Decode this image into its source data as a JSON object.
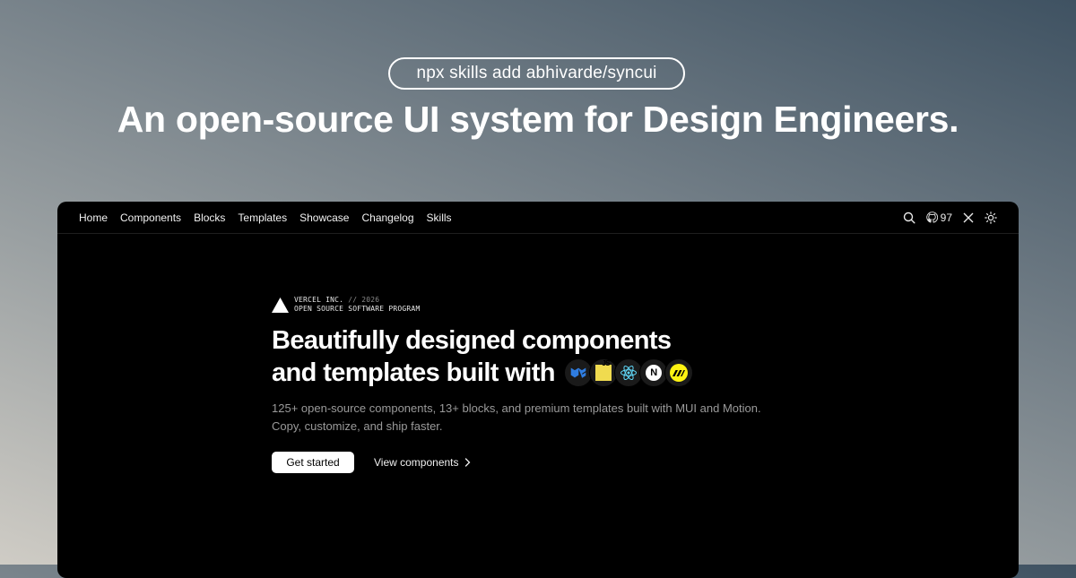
{
  "top": {
    "command": "npx skills add abhivarde/syncui",
    "headline": "An open-source UI system for Design Engineers."
  },
  "nav": {
    "items": [
      {
        "label": "Home"
      },
      {
        "label": "Components"
      },
      {
        "label": "Blocks"
      },
      {
        "label": "Templates"
      },
      {
        "label": "Showcase"
      },
      {
        "label": "Changelog"
      },
      {
        "label": "Skills"
      }
    ],
    "github_stars": "97",
    "icons": [
      "search-icon",
      "github-icon",
      "x-icon",
      "sun-icon"
    ]
  },
  "hero": {
    "badge_org": "VERCEL INC.",
    "badge_sep": " // 2026",
    "badge_program": "OPEN SOURCE SOFTWARE PROGRAM",
    "title_line1": "Beautifully designed components",
    "title_line2": "and templates built with",
    "tech_icons": [
      "mui-icon",
      "javascript-icon",
      "react-icon",
      "nextjs-icon",
      "motion-icon"
    ],
    "js_label": "JS",
    "next_label": "N",
    "desc_line1": "125+ open-source components, 13+ blocks, and premium templates built with MUI and Motion.",
    "desc_line2": "Copy, customize, and ship faster.",
    "primary_cta": "Get started",
    "secondary_cta": "View components"
  },
  "colors": {
    "window_bg": "#000000",
    "text": "#ffffff",
    "muted": "#9a9a9a",
    "mui_blue": "#2f7de1",
    "js_yellow": "#f0db4f",
    "react_cyan": "#61dafb",
    "motion_yellow": "#fff312"
  }
}
